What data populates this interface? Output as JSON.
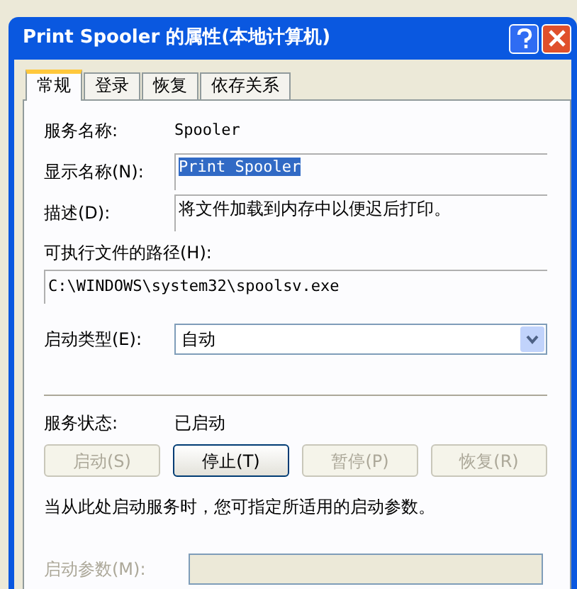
{
  "window": {
    "title": "Print Spooler 的属性(本地计算机)"
  },
  "tabs": [
    {
      "label": "常规",
      "selected": true
    },
    {
      "label": "登录",
      "selected": false
    },
    {
      "label": "恢复",
      "selected": false
    },
    {
      "label": "依存关系",
      "selected": false
    }
  ],
  "service_name": {
    "label": "服务名称:",
    "value": "Spooler"
  },
  "display_name": {
    "label": "显示名称(N):",
    "value": "Print Spooler"
  },
  "description": {
    "label": "描述(D):",
    "value": "将文件加载到内存中以便迟后打印。"
  },
  "path": {
    "label": "可执行文件的路径(H):",
    "value": "C:\\WINDOWS\\system32\\spoolsv.exe"
  },
  "startup_type": {
    "label": "启动类型(E):",
    "value": "自动"
  },
  "status": {
    "label": "服务状态:",
    "value": "已启动"
  },
  "buttons": [
    {
      "label": "启动(S)",
      "disabled": true
    },
    {
      "label": "停止(T)",
      "disabled": false
    },
    {
      "label": "暂停(P)",
      "disabled": true
    },
    {
      "label": "恢复(R)",
      "disabled": true
    }
  ],
  "hint": "当从此处启动服务时，您可指定所适用的启动参数。",
  "start_params": {
    "label": "启动参数(M):",
    "disabled": true
  }
}
